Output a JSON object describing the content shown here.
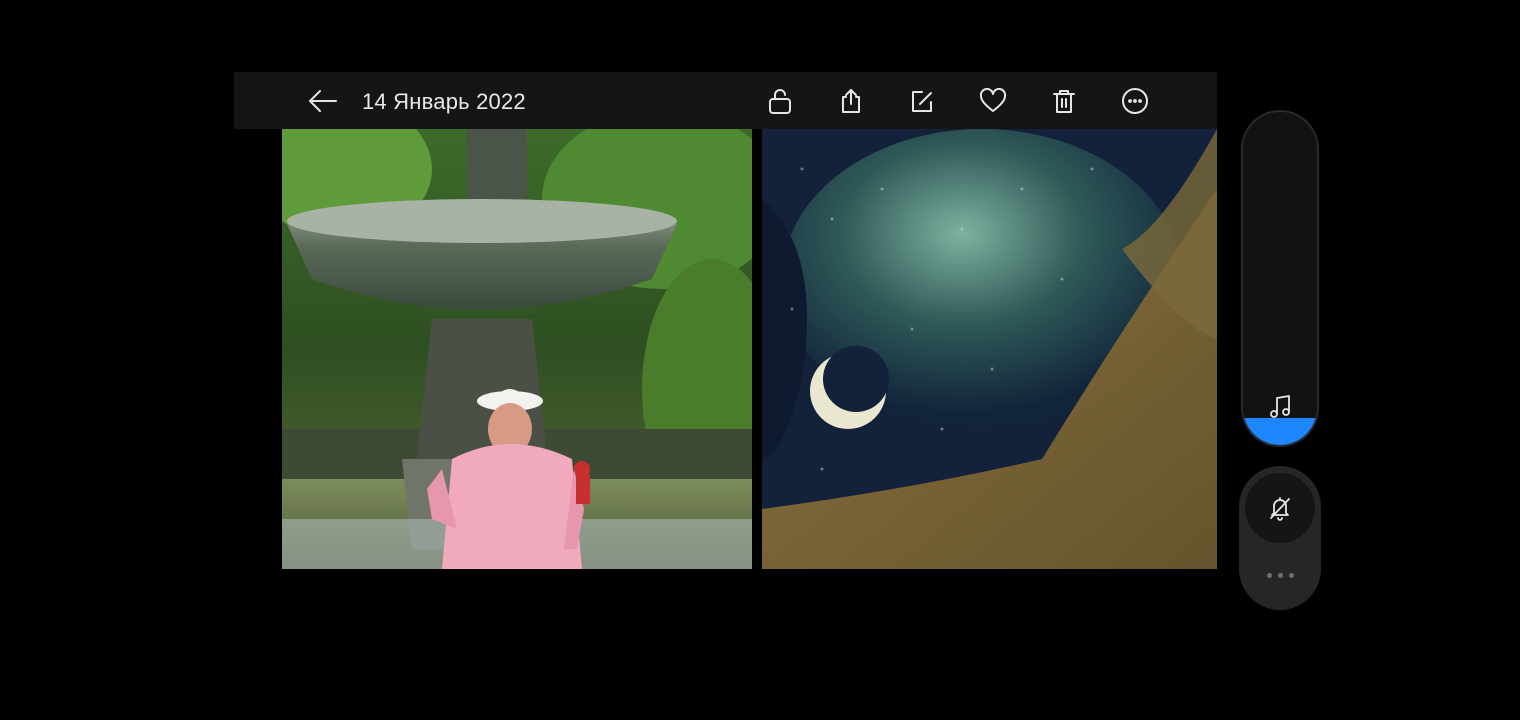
{
  "header": {
    "date_title": "14 Январь 2022"
  },
  "icons": {
    "back": "arrow-left-icon",
    "actions": [
      "unlock-icon",
      "share-icon",
      "edit-icon",
      "heart-icon",
      "trash-icon",
      "more-circle-icon"
    ],
    "volume": "music-note-icon",
    "ringer": "bell-off-icon",
    "more": "more-dots-icon"
  },
  "volume": {
    "level_fraction": 0.08
  },
  "colors": {
    "accent": "#1e86ff",
    "topbar": "#151515",
    "background": "#000000"
  }
}
